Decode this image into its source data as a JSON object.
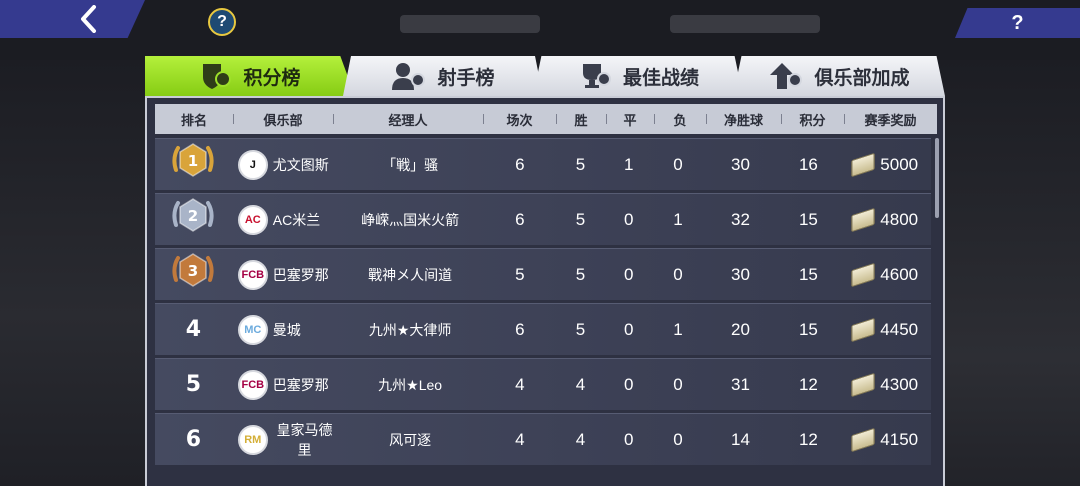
{
  "nav": {
    "back_icon": "chevron-left-icon",
    "help_small": "?",
    "help_label": "?"
  },
  "tabs": [
    {
      "label": "积分榜",
      "icon": "standings-badge-icon",
      "active": true
    },
    {
      "label": "射手榜",
      "icon": "scorer-user-icon",
      "active": false
    },
    {
      "label": "最佳战绩",
      "icon": "trophy-icon",
      "active": false
    },
    {
      "label": "俱乐部加成",
      "icon": "club-boost-icon",
      "active": false
    }
  ],
  "table": {
    "columns": [
      "排名",
      "俱乐部",
      "经理人",
      "场次",
      "胜",
      "平",
      "负",
      "净胜球",
      "积分",
      "赛季奖励"
    ],
    "rows": [
      {
        "rank": "1",
        "medal": "gold",
        "club": "尤文图斯",
        "logo": "J",
        "logo_color": "#111111",
        "manager": "「戦」骚",
        "played": "6",
        "win": "5",
        "draw": "1",
        "loss": "0",
        "gd": "30",
        "pts": "16",
        "reward": "5000"
      },
      {
        "rank": "2",
        "medal": "silver",
        "club": "AC米兰",
        "logo": "AC",
        "logo_color": "#c8102e",
        "manager": "峥嵘灬国米火箭",
        "played": "6",
        "win": "5",
        "draw": "0",
        "loss": "1",
        "gd": "32",
        "pts": "15",
        "reward": "4800"
      },
      {
        "rank": "3",
        "medal": "bronze",
        "club": "巴塞罗那",
        "logo": "FCB",
        "logo_color": "#a50044",
        "manager": "戰神メ人间道",
        "played": "5",
        "win": "5",
        "draw": "0",
        "loss": "0",
        "gd": "30",
        "pts": "15",
        "reward": "4600"
      },
      {
        "rank": "4",
        "medal": "",
        "club": "曼城",
        "logo": "MC",
        "logo_color": "#6cabdd",
        "manager": "九州★大律师",
        "played": "6",
        "win": "5",
        "draw": "0",
        "loss": "1",
        "gd": "20",
        "pts": "15",
        "reward": "4450"
      },
      {
        "rank": "5",
        "medal": "",
        "club": "巴塞罗那",
        "logo": "FCB",
        "logo_color": "#a50044",
        "manager": "九州★Leo",
        "played": "4",
        "win": "4",
        "draw": "0",
        "loss": "0",
        "gd": "31",
        "pts": "12",
        "reward": "4300"
      },
      {
        "rank": "6",
        "medal": "",
        "club": "皇家马德里",
        "logo": "RM",
        "logo_color": "#d4af37",
        "manager": "风可逐",
        "played": "4",
        "win": "4",
        "draw": "0",
        "loss": "0",
        "gd": "14",
        "pts": "12",
        "reward": "4150"
      }
    ]
  },
  "colors": {
    "accent": "#9ee02a",
    "nav": "#353a8f",
    "gold": "#d9a43a",
    "silver": "#a9b4c8",
    "bronze": "#c27a3c"
  }
}
